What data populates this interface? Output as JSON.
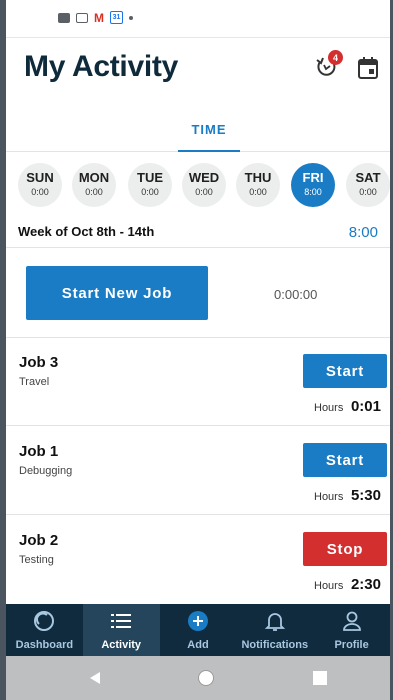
{
  "statusbar": {
    "icons": [
      "image-icon",
      "card-icon",
      "gmail-icon",
      "calendar-31-icon",
      "dot-icon"
    ],
    "calendar_day": "31"
  },
  "header": {
    "title": "My Activity",
    "sync_badge_count": "4",
    "sync_icon": "sync-icon",
    "calendar_icon": "calendar-icon"
  },
  "tabs": {
    "time_label": "TIME"
  },
  "days": [
    {
      "name": "SUN",
      "hours": "0:00",
      "active": false
    },
    {
      "name": "MON",
      "hours": "0:00",
      "active": false
    },
    {
      "name": "TUE",
      "hours": "0:00",
      "active": false
    },
    {
      "name": "WED",
      "hours": "0:00",
      "active": false
    },
    {
      "name": "THU",
      "hours": "0:00",
      "active": false
    },
    {
      "name": "FRI",
      "hours": "8:00",
      "active": true
    },
    {
      "name": "SAT",
      "hours": "0:00",
      "active": false
    }
  ],
  "week": {
    "label": "Week of  Oct 8th - 14th",
    "total": "8:00"
  },
  "new_job": {
    "button_label": "Start New Job",
    "timer": "0:00:00"
  },
  "jobs": [
    {
      "name": "Job 3",
      "task": "Travel",
      "action": "Start",
      "hours_label": "Hours",
      "hours": "0:01"
    },
    {
      "name": "Job 1",
      "task": "Debugging",
      "action": "Start",
      "hours_label": "Hours",
      "hours": "5:30"
    },
    {
      "name": "Job 2",
      "task": "Testing",
      "action": "Stop",
      "hours_label": "Hours",
      "hours": "2:30"
    }
  ],
  "bottom_nav": {
    "items": [
      {
        "label": "Dashboard",
        "icon": "dashboard-icon",
        "active": false
      },
      {
        "label": "Activity",
        "icon": "list-icon",
        "active": true
      },
      {
        "label": "Add",
        "icon": "add-icon",
        "active": false
      },
      {
        "label": "Notifications",
        "icon": "bell-icon",
        "active": false
      },
      {
        "label": "Profile",
        "icon": "person-icon",
        "active": false
      }
    ]
  },
  "colors": {
    "accent": "#1a7cc4",
    "stop": "#d32f2f",
    "nav_bg": "#0f2b3d",
    "title": "#0e2a3b"
  }
}
